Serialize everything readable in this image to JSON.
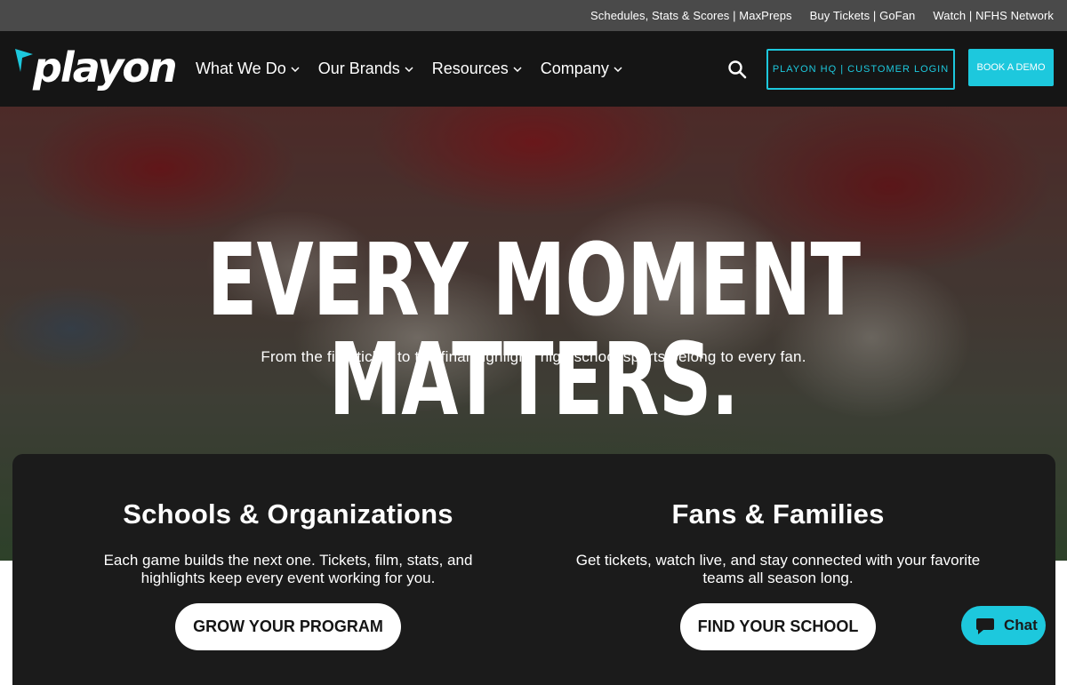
{
  "topbar": {
    "links": [
      "Schedules, Stats & Scores | MaxPreps",
      "Buy Tickets | GoFan",
      "Watch | NFHS Network"
    ]
  },
  "nav": {
    "logo_text": "playon",
    "menu": [
      {
        "label": "What We Do"
      },
      {
        "label": "Our Brands"
      },
      {
        "label": "Resources"
      },
      {
        "label": "Company"
      }
    ],
    "login_label": "PLAYON HQ | CUSTOMER LOGIN",
    "demo_label": "BOOK A DEMO"
  },
  "hero": {
    "title": "EVERY MOMENT MATTERS.",
    "subtitle": "From the first ticket to the final highlight, high school sports belong to every fan."
  },
  "panel": {
    "schools": {
      "title": "Schools & Organizations",
      "text": "Each game builds the next one. Tickets, film, stats, and highlights keep every event working for you.",
      "cta": "GROW YOUR PROGRAM"
    },
    "fans": {
      "title": "Fans & Families",
      "text": "Get tickets, watch live, and stay connected with your favorite teams all season long.",
      "cta": "FIND YOUR SCHOOL"
    }
  },
  "chat": {
    "label": "Chat"
  },
  "colors": {
    "accent": "#1dc8dd",
    "nav_bg": "#151515",
    "topbar_bg": "#4a4a4a",
    "panel_bg": "#1b1b1b"
  }
}
